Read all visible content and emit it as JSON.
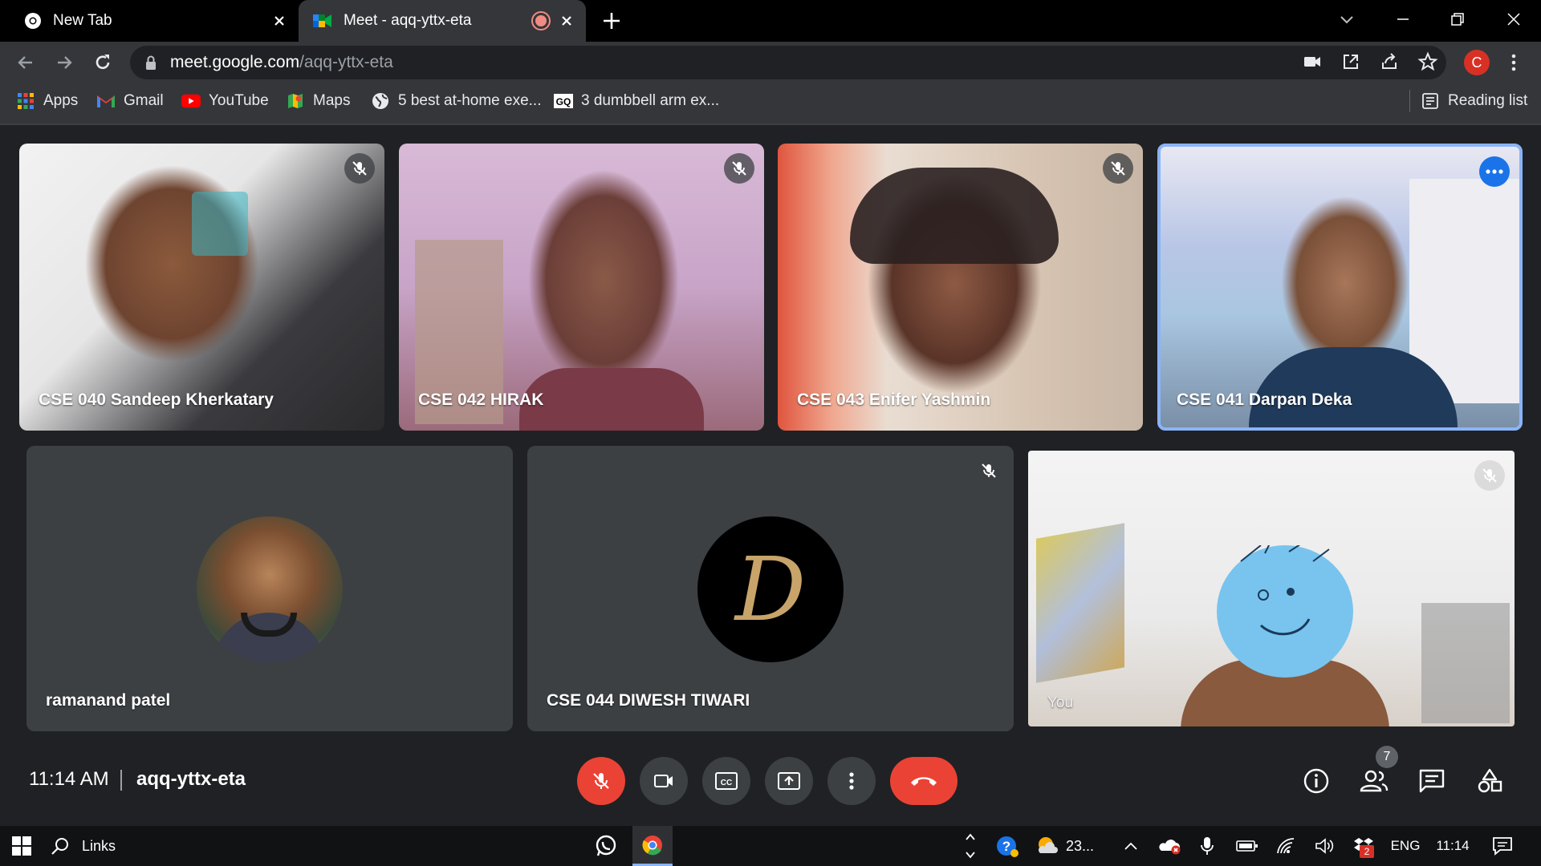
{
  "browser": {
    "tabs": [
      {
        "title": "New Tab",
        "active": false
      },
      {
        "title": "Meet - aqq-yttx-eta",
        "active": true
      }
    ],
    "url_host": "meet.google.com",
    "url_path": "/aqq-yttx-eta",
    "profile_initial": "C",
    "bookmarks": [
      {
        "label": "Apps",
        "icon": "apps-grid-icon"
      },
      {
        "label": "Gmail",
        "icon": "gmail-icon"
      },
      {
        "label": "YouTube",
        "icon": "youtube-icon"
      },
      {
        "label": "Maps",
        "icon": "maps-icon"
      },
      {
        "label": "5 best at-home exe...",
        "icon": "globe-icon"
      },
      {
        "label": "3 dumbbell arm ex...",
        "icon": "gq-icon"
      }
    ],
    "reading_list": "Reading list"
  },
  "meet": {
    "participants": [
      {
        "name": "CSE 040 Sandeep Kherkatary",
        "muted": true
      },
      {
        "name": "CSE 042 HIRAK",
        "muted": true
      },
      {
        "name": "CSE 043 Enifer Yashmin",
        "muted": true
      },
      {
        "name": "CSE 041 Darpan Deka",
        "muted": false,
        "speaking": true
      },
      {
        "name": "ramanand patel",
        "muted": false
      },
      {
        "name": "CSE 044 DIWESH TIWARI",
        "muted": true
      },
      {
        "name": "You",
        "muted": true
      }
    ],
    "avatar_letter": "D",
    "time": "11:14 AM",
    "meeting_code": "aqq-yttx-eta",
    "people_count": "7",
    "colors": {
      "accent": "#8ab4f8",
      "end_call": "#ea4335",
      "tile_bg": "#3c4043"
    }
  },
  "taskbar": {
    "search_label": "Links",
    "weather": "23...",
    "language": "ENG",
    "clock": "11:14",
    "notification_badge": "2"
  }
}
